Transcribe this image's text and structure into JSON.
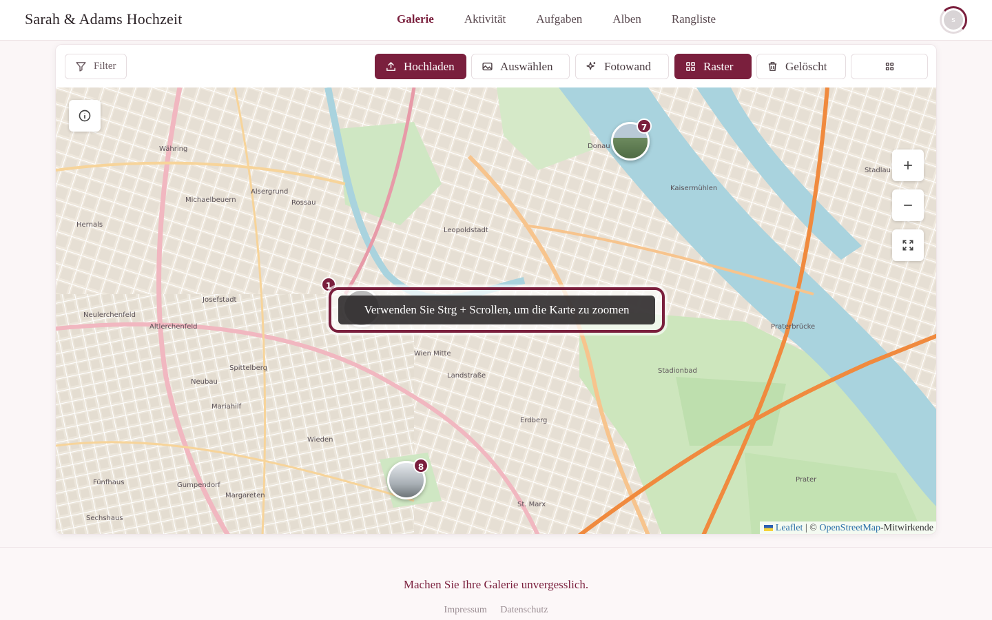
{
  "header": {
    "brand": "Sarah & Adams Hochzeit",
    "nav": [
      "Galerie",
      "Aktivität",
      "Aufgaben",
      "Alben",
      "Rangliste"
    ],
    "active_nav": "Galerie",
    "avatar_initial": "s"
  },
  "toolbar": {
    "filter": "Filter",
    "upload": "Hochladen",
    "select": "Auswählen",
    "photowall": "Fotowand",
    "grid": "Raster",
    "deleted": "Gelöscht"
  },
  "map": {
    "clusters": [
      {
        "count": "7"
      },
      {
        "count": "1"
      },
      {
        "count": "8"
      }
    ],
    "zoom_hint": "Verwenden Sie Strg + Scrollen, um die Karte zu zoomen",
    "attribution": {
      "leaflet": "Leaflet",
      "separator": "| ©",
      "osm": "OpenStreetMap",
      "suffix": "-Mitwirkende"
    },
    "labels": [
      "Währing",
      "Alsergrund",
      "Leopoldstadt",
      "Josefstadt",
      "Neubau",
      "Mariahilf",
      "Wieden",
      "Landstraße",
      "Erdberg",
      "Margareten",
      "Praterbrücke",
      "Stadionbad",
      "Prater",
      "Donau",
      "Hernals",
      "Neulerchenfeld",
      "Sechshaus",
      "Fünfhaus",
      "Gumpendorf",
      "Wien Mitte",
      "Rossau",
      "Michaelbeuern",
      "Altlerchenfeld",
      "Spittelberg",
      "St. Marx",
      "Stadlau",
      "Kaisermühlen"
    ]
  },
  "footer": {
    "tagline": "Machen Sie Ihre Galerie unvergesslich.",
    "links": [
      "Impressum",
      "Datenschutz"
    ]
  },
  "colors": {
    "accent": "#7a1f3d"
  }
}
